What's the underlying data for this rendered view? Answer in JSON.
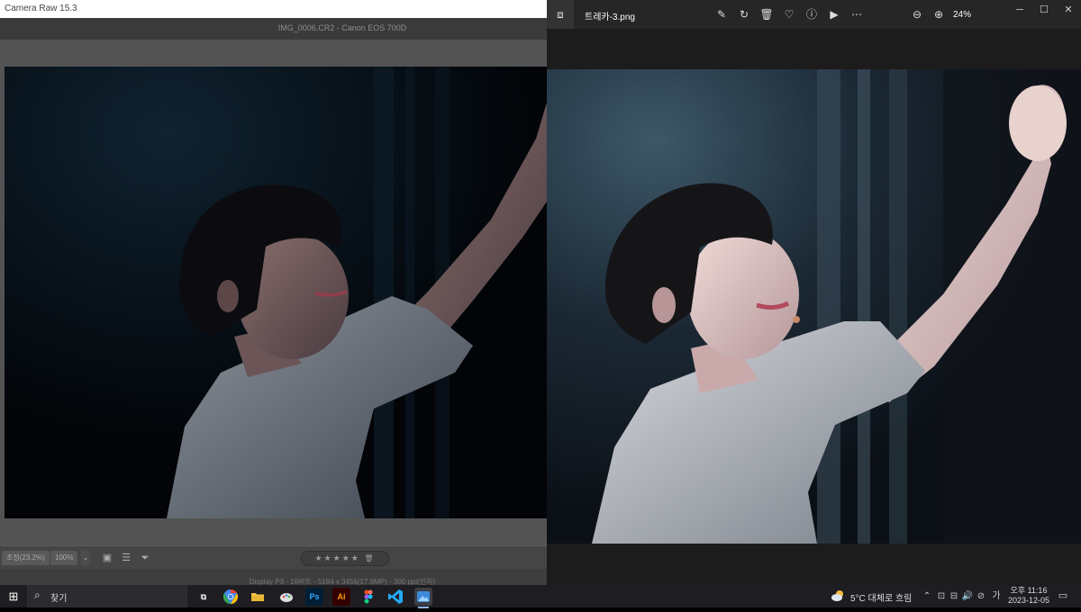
{
  "camera_raw": {
    "title": "Camera Raw 15.3",
    "header": "IMG_0006.CR2  -  Canon EOS 700D",
    "zoom_fit": "조정(23.2%)",
    "zoom_100": "100%",
    "zoom_dropdown": "⌄",
    "rating_stars": "★★★★★",
    "delete_icon": "🗑",
    "info_text": "Display P3 - 16비트 - 5184 x 3456(17.9MP) - 300 ppi(인치)"
  },
  "photos": {
    "filename": "트레카-3.png",
    "zoom_value": "24%"
  },
  "taskbar": {
    "search_placeholder": "찾기",
    "weather": "5°C  대체로 흐림",
    "time": "오후 11:16",
    "date": "2023-12-05",
    "apps": [
      {
        "name": "task-view",
        "label": "⧉"
      },
      {
        "name": "chrome",
        "label": ""
      },
      {
        "name": "file-explorer",
        "label": ""
      },
      {
        "name": "paint",
        "label": ""
      },
      {
        "name": "photoshop",
        "label": "Ps"
      },
      {
        "name": "illustrator",
        "label": "Ai"
      },
      {
        "name": "figma",
        "label": ""
      },
      {
        "name": "vscode",
        "label": ""
      },
      {
        "name": "photos",
        "label": ""
      }
    ]
  },
  "colors": {
    "photoshop": "#001e36",
    "photoshop_text": "#31a8ff",
    "illustrator": "#330000",
    "illustrator_text": "#ff9a00",
    "vscode": "#23a9f2",
    "chrome_red": "#ea4335",
    "chrome_yellow": "#fbbc05",
    "chrome_green": "#34a853",
    "chrome_blue": "#4285f4",
    "folder": "#f4c542",
    "photos_app": "#3c8ad8"
  }
}
